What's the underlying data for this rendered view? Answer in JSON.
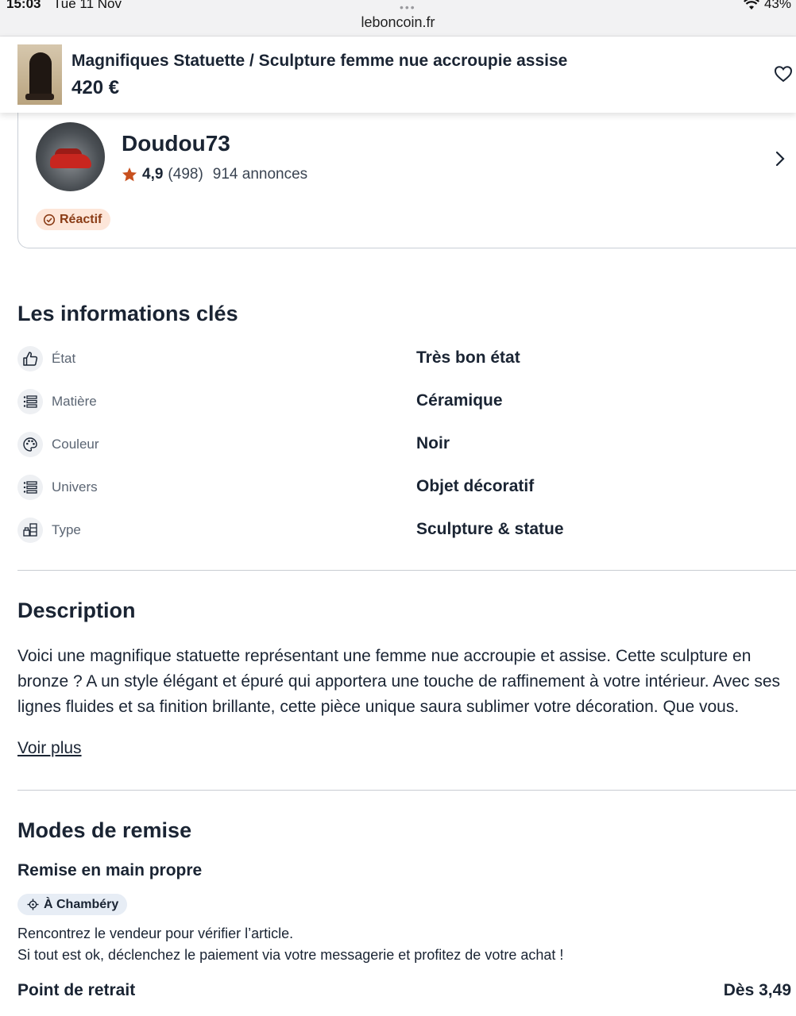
{
  "status_bar": {
    "time": "15:03",
    "date": "Tue 11 Nov",
    "url": "leboncoin.fr",
    "battery": "43%"
  },
  "ad": {
    "title": "Magnifiques Statuette / Sculpture femme nue accroupie assise",
    "price": "420 €"
  },
  "seller": {
    "name": "Doudou73",
    "rating": "4,9",
    "reviews": "(498)",
    "ads_count": "914 annonces",
    "badge": "Réactif"
  },
  "key_info": {
    "title": "Les informations clés",
    "rows": [
      {
        "label": "État",
        "value": "Très bon état",
        "icon": "thumbs-up-icon"
      },
      {
        "label": "Matière",
        "value": "Céramique",
        "icon": "list-icon"
      },
      {
        "label": "Couleur",
        "value": "Noir",
        "icon": "palette-icon"
      },
      {
        "label": "Univers",
        "value": "Objet décoratif",
        "icon": "list-icon"
      },
      {
        "label": "Type",
        "value": "Sculpture & statue",
        "icon": "furniture-icon"
      }
    ]
  },
  "description": {
    "title": "Description",
    "text": "Voici une magnifique statuette représentant une femme nue accroupie et assise. Cette sculpture en bronze ? A un style élégant et épuré qui apportera une touche de raffinement à votre intérieur. Avec ses lignes fluides et sa finition brillante, cette pièce unique saura sublimer votre décoration. Que vous.",
    "more_link": "Voir plus"
  },
  "delivery": {
    "title": "Modes de remise",
    "hand_delivery": {
      "title": "Remise en main propre",
      "location": "À Chambéry",
      "line1": "Rencontrez le vendeur pour vérifier l’article.",
      "line2": "Si tout est ok, déclenchez le paiement via votre messagerie et profitez de votre achat !"
    },
    "pickup_point": {
      "title": "Point de retrait",
      "price": "Dès 3,49"
    }
  },
  "colors": {
    "text": "#1a2433",
    "badge_bg": "#fde6d9",
    "badge_text": "#8a3c16",
    "star": "#c8501e",
    "pill_bg": "#e7edf5"
  }
}
